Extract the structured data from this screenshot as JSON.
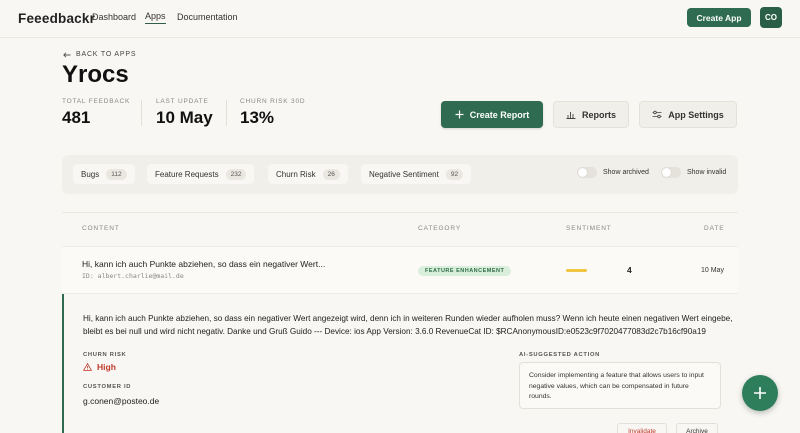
{
  "app": {
    "brand": "Feeedbackr"
  },
  "nav": {
    "dashboard": "Dashboard",
    "apps": "Apps",
    "documentation": "Documentation"
  },
  "header": {
    "create_app": "Create App",
    "avatar_initials": "CO"
  },
  "page": {
    "back": "BACK TO APPS",
    "title": "Yrocs"
  },
  "stats": [
    {
      "label": "TOTAL FEEDBACK",
      "value": "481"
    },
    {
      "label": "LAST UPDATE",
      "value": "10 May"
    },
    {
      "label": "CHURN RISK 30D",
      "value": "13%"
    }
  ],
  "actions": {
    "create_report": "Create Report",
    "reports": "Reports",
    "app_settings": "App Settings"
  },
  "filters": [
    {
      "label": "Bugs",
      "count": "112"
    },
    {
      "label": "Feature Requests",
      "count": "232"
    },
    {
      "label": "Churn Risk",
      "count": "26"
    },
    {
      "label": "Negative Sentiment",
      "count": "92"
    }
  ],
  "toggles": {
    "show_archived": "Show archived",
    "show_invalid": "Show invalid"
  },
  "table": {
    "headers": {
      "content": "CONTENT",
      "category": "CATEGORY",
      "sentiment": "SENTIMENT",
      "date": "DATE"
    },
    "rows": [
      {
        "content": "Hi, kann ich auch Punkte abziehen, so dass ein negativer Wert...",
        "id": "ID: albert.charlie@mail.de",
        "category": "FEATURE ENHANCEMENT",
        "sentiment": "4",
        "date": "10 May"
      }
    ]
  },
  "detail": {
    "text": "Hi, kann ich auch Punkte abziehen, so dass ein negativer Wert angezeigt wird, denn ich in weiteren Runden wieder aufholen muss? Wenn ich heute einen negativen Wert eingebe, bleibt es bei null und wird nicht negativ. Danke und Gruß Guido --- Device: ios App Version: 3.6.0 RevenueCat ID: $RCAnonymousID:e0523c9f7020477083d2c7b16cf90a19",
    "churn_label": "CHURN RISK",
    "churn_value": "High",
    "customer_label": "CUSTOMER ID",
    "customer_value": "g.conen@posteo.de",
    "ai_label": "AI-SUGGESTED ACTION",
    "ai_text": "Consider implementing a feature that allows users to input negative values, which can be compensated in future rounds.",
    "invalidate": "Invalidate",
    "archive": "Archive"
  },
  "colors": {
    "accent": "#2e6b50",
    "danger": "#c0392b",
    "sentiment_bar": "#f0c541"
  }
}
